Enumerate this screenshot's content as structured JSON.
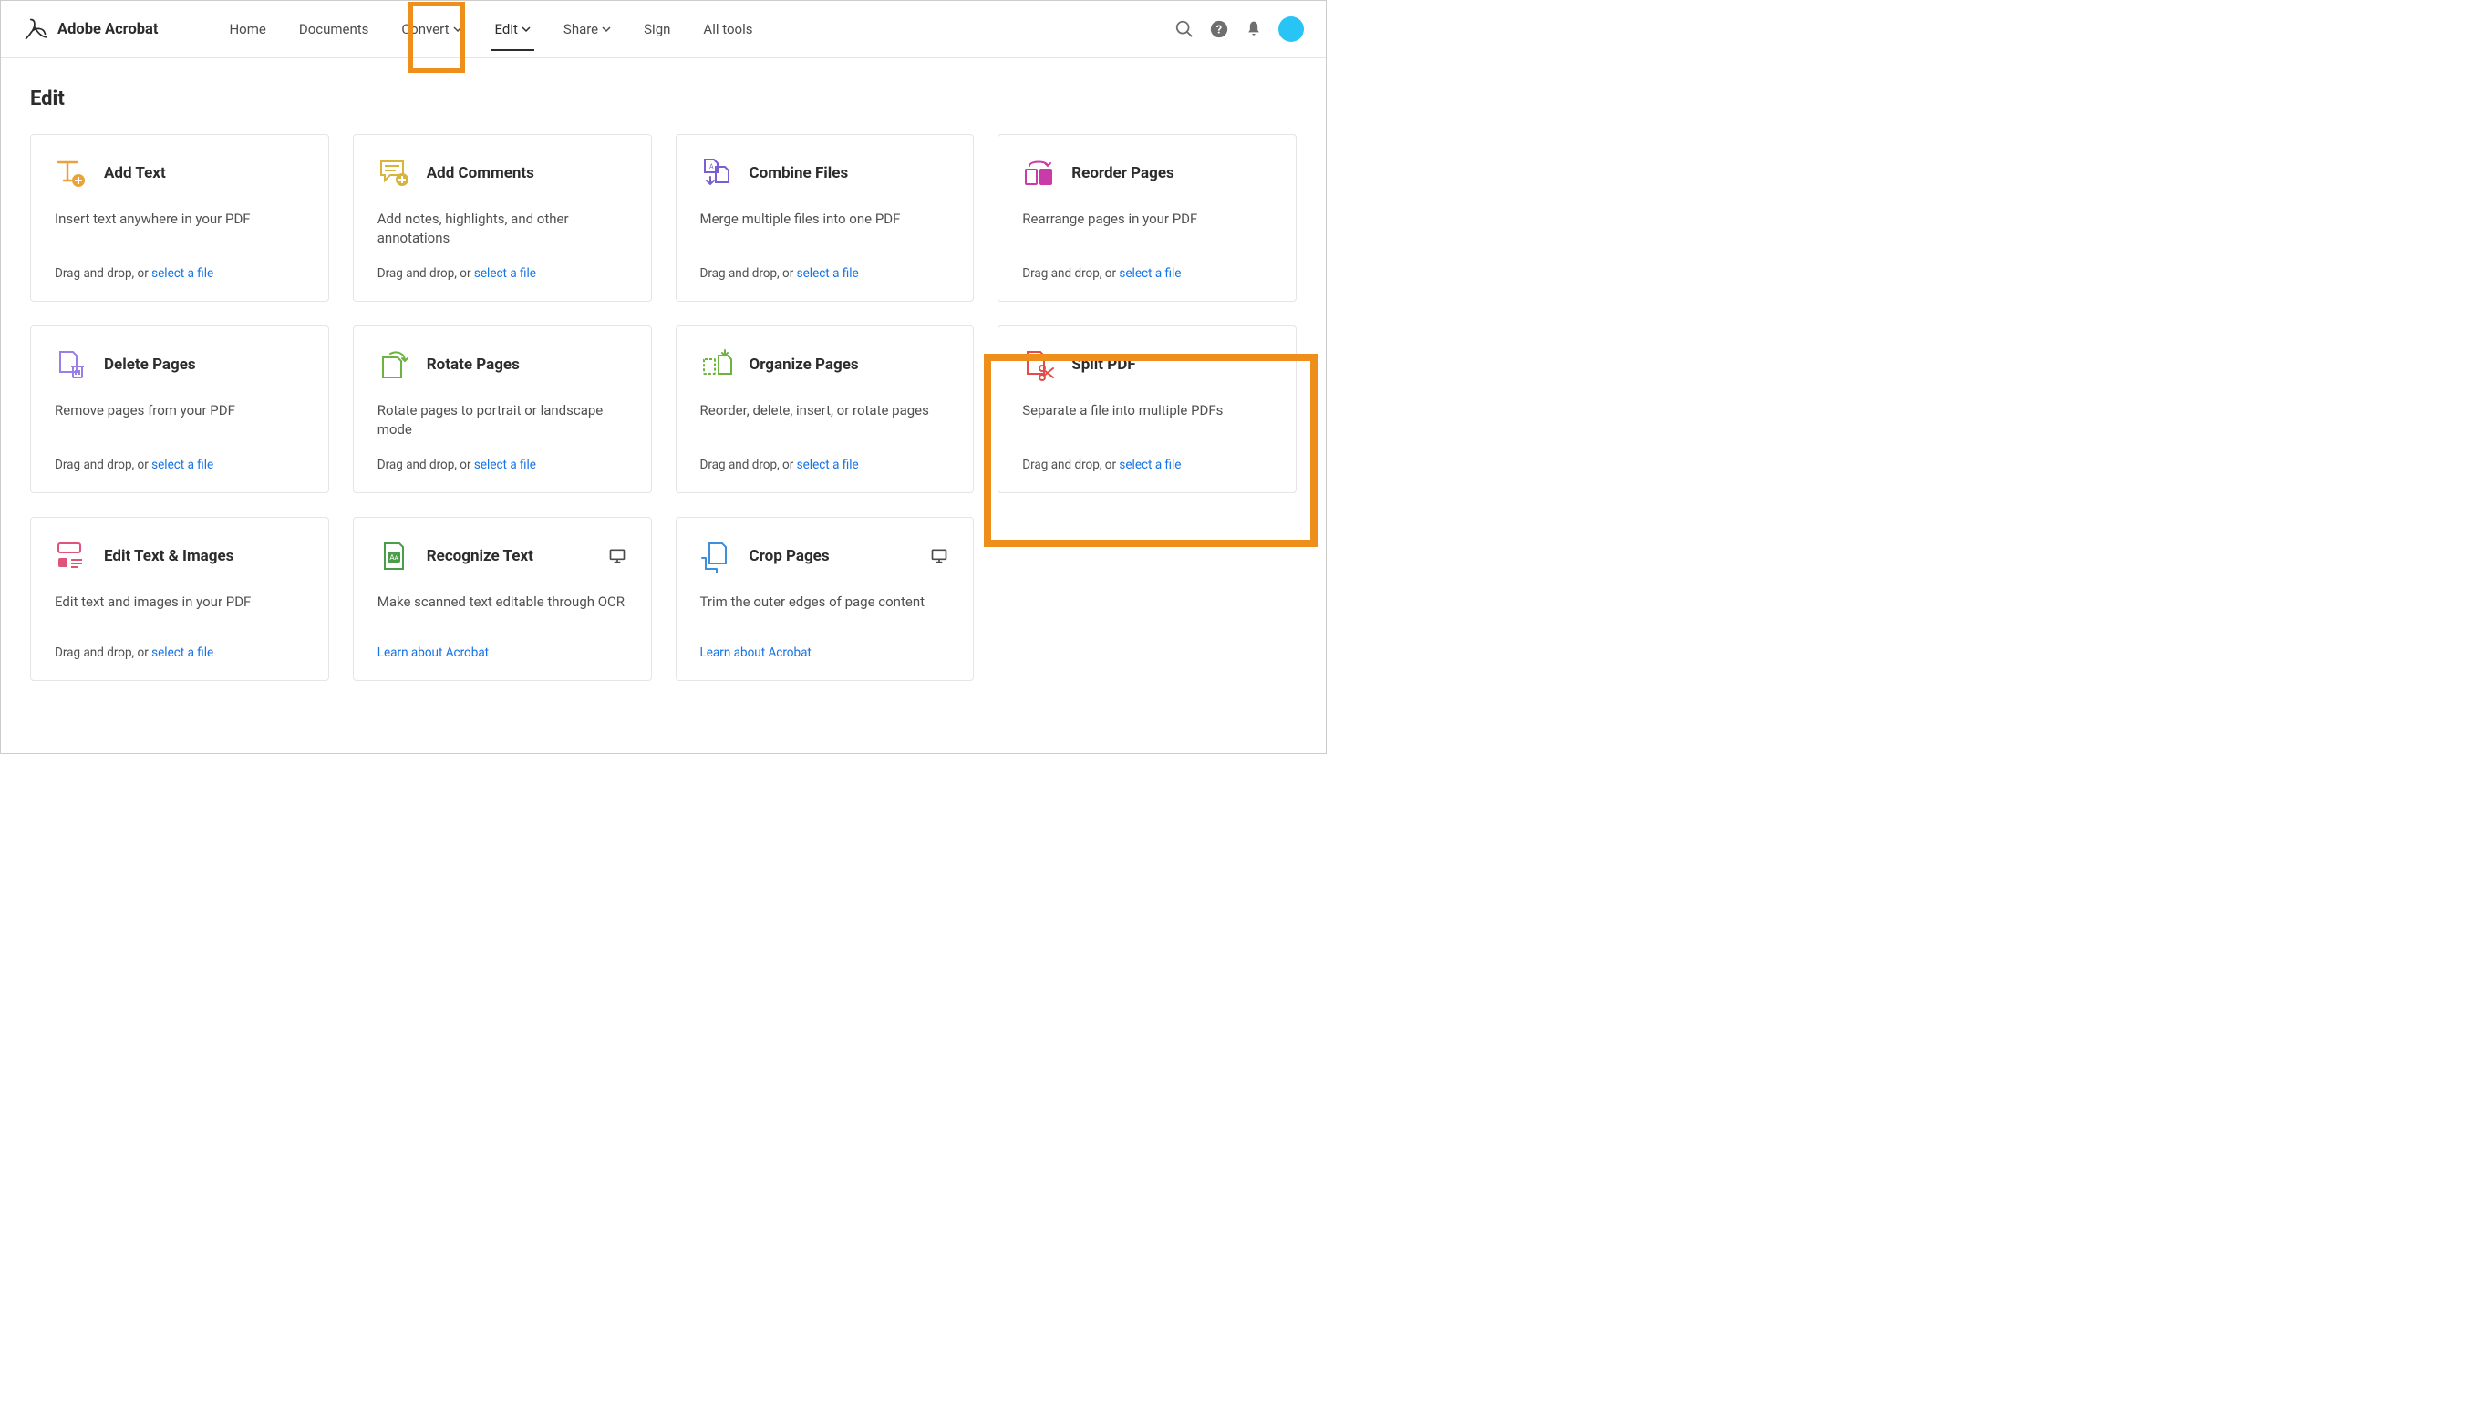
{
  "app_name": "Adobe Acrobat",
  "nav": {
    "home": "Home",
    "documents": "Documents",
    "convert": "Convert",
    "edit": "Edit",
    "share": "Share",
    "sign": "Sign",
    "all_tools": "All tools"
  },
  "page_title": "Edit",
  "drag_text": "Drag and drop, or ",
  "select_link": "select a file",
  "learn_link": "Learn about Acrobat",
  "cards": {
    "add_text": {
      "title": "Add Text",
      "desc": "Insert text anywhere in your PDF"
    },
    "add_comments": {
      "title": "Add Comments",
      "desc": "Add notes, highlights, and other annotations"
    },
    "combine": {
      "title": "Combine Files",
      "desc": "Merge multiple files into one PDF"
    },
    "reorder": {
      "title": "Reorder Pages",
      "desc": "Rearrange pages in your PDF"
    },
    "delete": {
      "title": "Delete Pages",
      "desc": "Remove pages from your PDF"
    },
    "rotate": {
      "title": "Rotate Pages",
      "desc": "Rotate pages to portrait or landscape mode"
    },
    "organize": {
      "title": "Organize Pages",
      "desc": "Reorder, delete, insert, or rotate pages"
    },
    "split": {
      "title": "Split PDF",
      "desc": "Separate a file into multiple PDFs"
    },
    "edit_ti": {
      "title": "Edit Text & Images",
      "desc": "Edit text and images in your PDF"
    },
    "recognize": {
      "title": "Recognize Text",
      "desc": "Make scanned text editable through OCR"
    },
    "crop": {
      "title": "Crop Pages",
      "desc": "Trim the outer edges of page content"
    }
  }
}
